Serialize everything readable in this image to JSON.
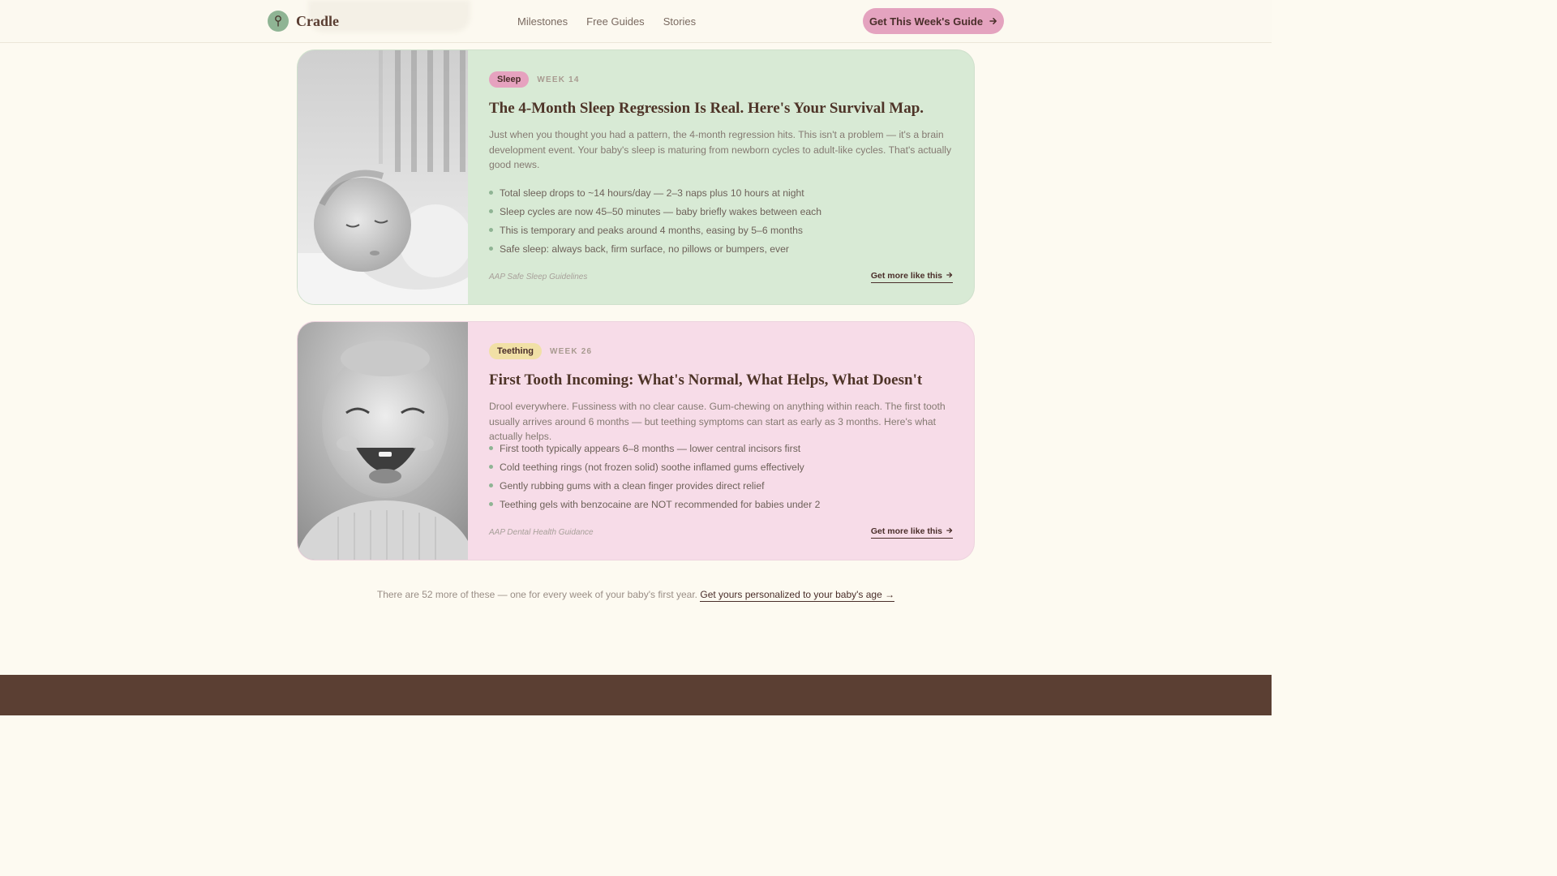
{
  "header": {
    "brand": "Cradle",
    "nav": [
      "Milestones",
      "Free Guides",
      "Stories"
    ],
    "cta_label": "Get This Week's Guide"
  },
  "cards": [
    {
      "tag": "Sleep",
      "week": "WEEK 14",
      "title": "The 4-Month Sleep Regression Is Real. Here's Your Survival Map.",
      "description": "Just when you thought you had a pattern, the 4-month regression hits. This isn't a problem — it's a brain development event. Your baby's sleep is maturing from newborn cycles to adult-like cycles. That's actually good news.",
      "bullets": [
        "Total sleep drops to ~14 hours/day — 2–3 naps plus 10 hours at night",
        "Sleep cycles are now 45–50 minutes — baby briefly wakes between each",
        "This is temporary and peaks around 4 months, easing by 5–6 months",
        "Safe sleep: always back, firm surface, no pillows or bumpers, ever"
      ],
      "source": "AAP Safe Sleep Guidelines",
      "more_label": "Get more like this",
      "image": "sleeping-baby-photo"
    },
    {
      "tag": "Teething",
      "week": "WEEK 26",
      "title": "First Tooth Incoming: What's Normal, What Helps, What Doesn't",
      "description": "Drool everywhere. Fussiness with no clear cause. Gum-chewing on anything within reach. The first tooth usually arrives around 6 months — but teething symptoms can start as early as 3 months. Here's what actually helps.",
      "bullets": [
        "First tooth typically appears 6–8 months — lower central incisors first",
        "Cold teething rings (not frozen solid) soothe inflamed gums effectively",
        "Gently rubbing gums with a clean finger provides direct relief",
        "Teething gels with benzocaine are NOT recommended for babies under 2"
      ],
      "source": "AAP Dental Health Guidance",
      "more_label": "Get more like this",
      "image": "laughing-baby-photo"
    }
  ],
  "footer": {
    "note": "There are 52 more of these — one for every week of your baby's first year.",
    "link": "Get yours personalized to your baby's age →"
  },
  "colors": {
    "background": "#fdfaf1",
    "sleep_card": "#d8ead5",
    "teething_card": "#f7dce8",
    "accent_pink": "#e4a3bf",
    "accent_green": "#8fb494",
    "dark_brown": "#5b3f33"
  }
}
